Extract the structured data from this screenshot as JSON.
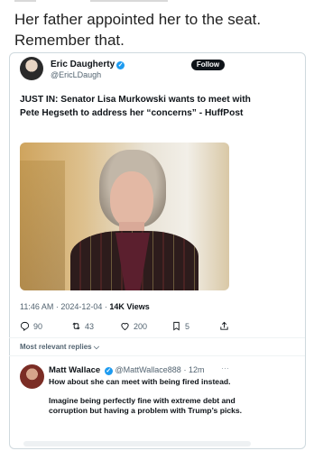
{
  "caption": "Her father appointed her to the seat. Remember that.",
  "tweet": {
    "author_name": "Eric Daugherty",
    "author_handle": "@EricLDaugh",
    "follow_label": "Follow",
    "text": "JUST IN: Senator Lisa Murkowski wants to meet with Pete Hegseth to address her “concerns” - HuffPost",
    "time": "11:46 AM · 2024-12-04 · ",
    "views": "14K Views",
    "replies": "90",
    "reposts": "43",
    "likes": "200",
    "bookmarks": "5"
  },
  "sort_label": "Most relevant replies",
  "reply": {
    "author_name": "Matt Wallace",
    "author_handle": "@MattWallace888",
    "time": "· 12m",
    "para1": "How about she can meet with being fired instead.",
    "para2": "Imagine being perfectly fine with extreme debt and corruption but having a problem with Trump’s picks."
  },
  "colors": {
    "verified": "#1d9bf0",
    "text": "#0f1419",
    "muted": "#536471"
  }
}
